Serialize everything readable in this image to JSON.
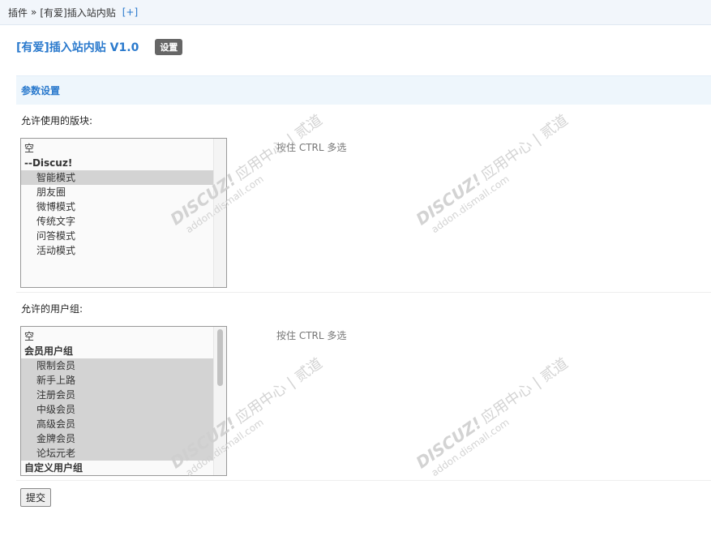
{
  "breadcrumb": {
    "plugins": "插件",
    "separator": "»",
    "current": "[有爱]插入站内贴",
    "add": "[+]"
  },
  "page": {
    "title": "[有爱]插入站内贴 V1.0",
    "settings_badge": "设置"
  },
  "section": {
    "title": "参数设置"
  },
  "forums_field": {
    "label": "允许使用的版块:",
    "hint": "按住 CTRL 多选",
    "options": [
      {
        "text": "空",
        "kind": "plain",
        "selected": false
      },
      {
        "text": "--Discuz!",
        "kind": "group",
        "selected": false
      },
      {
        "text": "智能模式",
        "kind": "child",
        "selected": true
      },
      {
        "text": "朋友圈",
        "kind": "child",
        "selected": false
      },
      {
        "text": "微博模式",
        "kind": "child",
        "selected": false
      },
      {
        "text": "传统文字",
        "kind": "child",
        "selected": false
      },
      {
        "text": "问答模式",
        "kind": "child",
        "selected": false
      },
      {
        "text": "活动模式",
        "kind": "child",
        "selected": false
      }
    ]
  },
  "groups_field": {
    "label": "允许的用户组:",
    "hint": "按住 CTRL 多选",
    "options": [
      {
        "text": "空",
        "kind": "plain",
        "selected": false
      },
      {
        "text": "会员用户组",
        "kind": "group",
        "selected": false
      },
      {
        "text": "限制会员",
        "kind": "child",
        "selected": true
      },
      {
        "text": "新手上路",
        "kind": "child",
        "selected": true
      },
      {
        "text": "注册会员",
        "kind": "child",
        "selected": true
      },
      {
        "text": "中级会员",
        "kind": "child",
        "selected": true
      },
      {
        "text": "高级会员",
        "kind": "child",
        "selected": true
      },
      {
        "text": "金牌会员",
        "kind": "child",
        "selected": true
      },
      {
        "text": "论坛元老",
        "kind": "child",
        "selected": true
      },
      {
        "text": "自定义用户组",
        "kind": "group",
        "selected": false
      }
    ]
  },
  "submit_label": "提交",
  "watermark": {
    "brand": "DISCUZ!",
    "cn": "应用中心 | 贰道",
    "url": "addon.dismall.com"
  },
  "colors": {
    "accent": "#2b7acd",
    "section_bg": "#eef6fc",
    "selected_bg": "#d3d3d3"
  }
}
